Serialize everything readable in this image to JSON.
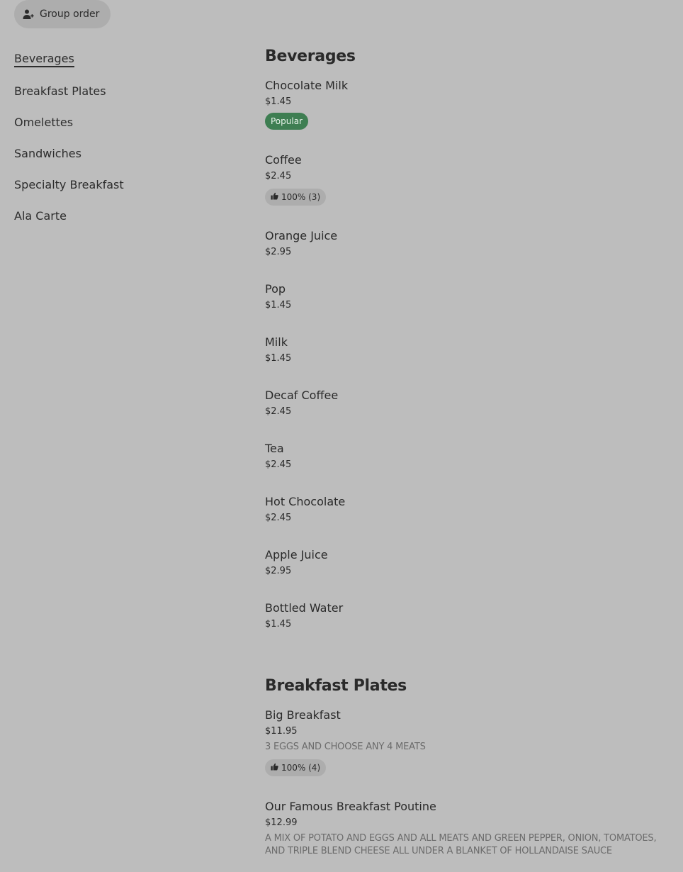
{
  "group_order": {
    "label": "Group order",
    "icon": "add-person-icon"
  },
  "categories": [
    {
      "label": "Beverages",
      "active": true
    },
    {
      "label": "Breakfast Plates",
      "active": false
    },
    {
      "label": "Omelettes",
      "active": false
    },
    {
      "label": "Sandwiches",
      "active": false
    },
    {
      "label": "Specialty Breakfast",
      "active": false
    },
    {
      "label": "Ala Carte",
      "active": false
    }
  ],
  "sections": [
    {
      "title": "Beverages",
      "items": [
        {
          "name": "Chocolate Milk",
          "price": "$1.45",
          "badge": "Popular"
        },
        {
          "name": "Coffee",
          "price": "$2.45",
          "rating": "100% (3)"
        },
        {
          "name": "Orange Juice",
          "price": "$2.95"
        },
        {
          "name": "Pop",
          "price": "$1.45"
        },
        {
          "name": "Milk",
          "price": "$1.45"
        },
        {
          "name": "Decaf Coffee",
          "price": "$2.45"
        },
        {
          "name": "Tea",
          "price": "$2.45"
        },
        {
          "name": "Hot Chocolate",
          "price": "$2.45"
        },
        {
          "name": "Apple Juice",
          "price": "$2.95"
        },
        {
          "name": "Bottled Water",
          "price": "$1.45"
        }
      ]
    },
    {
      "title": "Breakfast Plates",
      "items": [
        {
          "name": "Big Breakfast",
          "price": "$11.95",
          "description": "3 EGGS AND CHOOSE ANY 4 MEATS",
          "rating": "100% (4)"
        },
        {
          "name": "Our Famous Breakfast Poutine",
          "price": "$12.99",
          "description": "A MIX OF POTATO AND EGGS AND ALL MEATS AND GREEN PEPPER, ONION, TOMATOES, AND TRIPLE BLEND CHEESE ALL UNDER A BLANKET OF HOLLANDAISE SAUCE"
        }
      ]
    }
  ],
  "colors": {
    "background": "#bdbdbd",
    "popular_badge": "#3e7e52",
    "chip": "#adadad"
  }
}
